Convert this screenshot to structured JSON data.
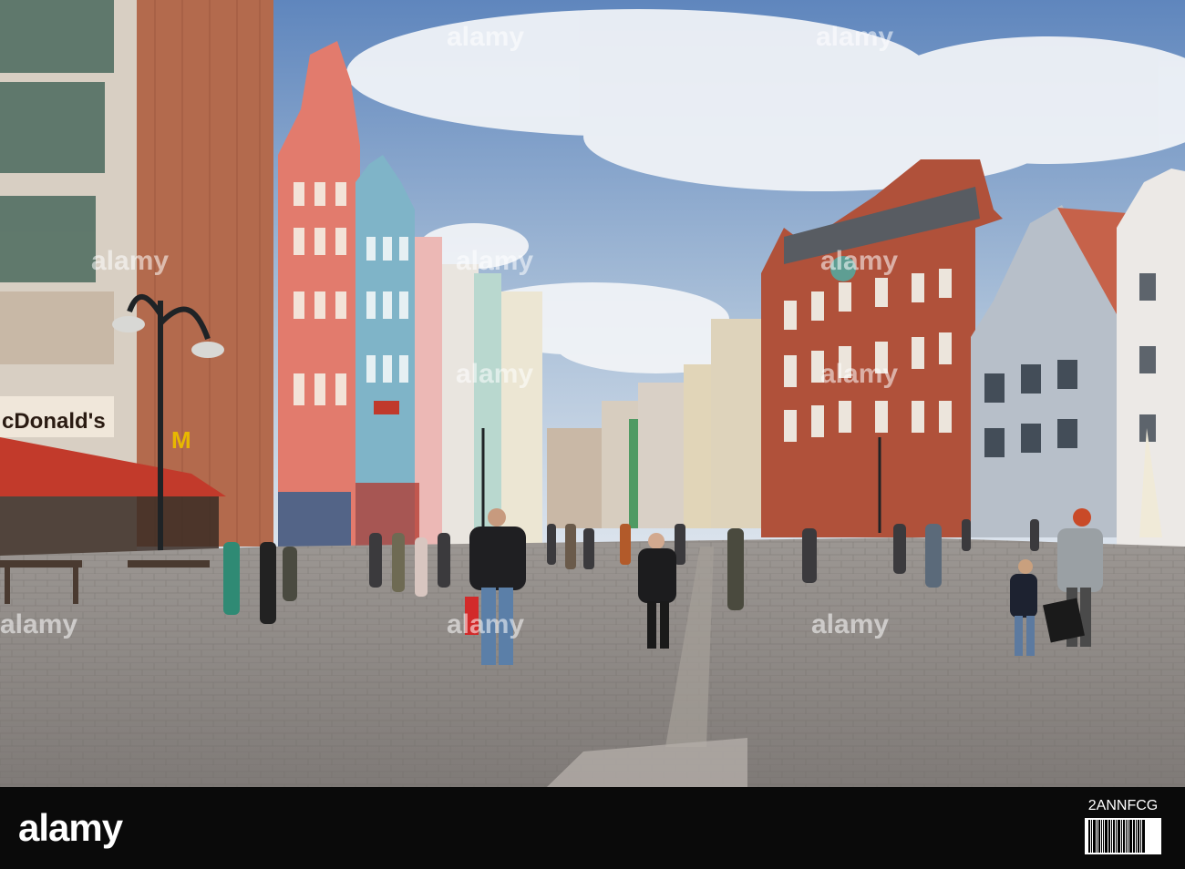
{
  "scene": {
    "storefront_signs": {
      "mcdonalds": "cDonald's"
    }
  },
  "watermark": {
    "text": "alamy"
  },
  "footer": {
    "logo": "alamy",
    "image_id": "2ANNFCG"
  },
  "colors": {
    "sky_top": "#5f86bd",
    "sky_bottom": "#cfdbe8",
    "pavement": "#8f8a86",
    "footer_bg": "#0a0a0a"
  }
}
